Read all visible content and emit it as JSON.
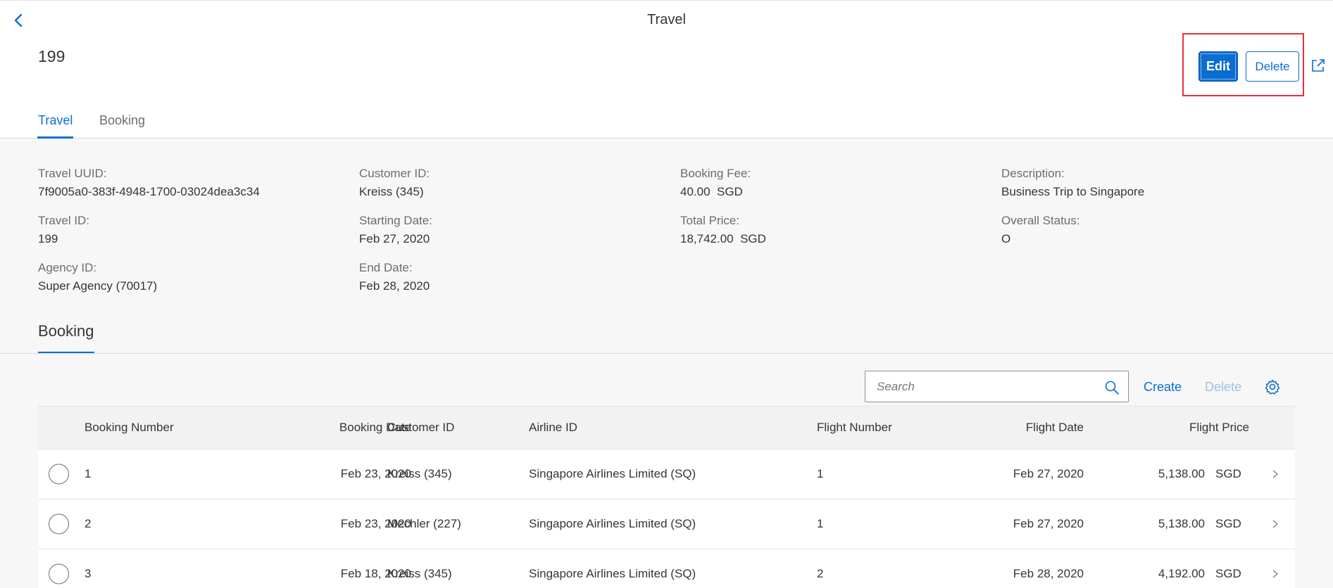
{
  "header": {
    "app_title": "Travel",
    "object_title": "199",
    "edit_label": "Edit",
    "delete_label": "Delete",
    "tabs": [
      {
        "label": "Travel",
        "selected": true
      },
      {
        "label": "Booking",
        "selected": false
      }
    ]
  },
  "details": {
    "fields": [
      {
        "label": "Travel UUID:",
        "value": "7f9005a0-383f-4948-1700-03024dea3c34"
      },
      {
        "label": "Travel ID:",
        "value": "199"
      },
      {
        "label": "Agency ID:",
        "value": "Super Agency (70017)"
      },
      {
        "label": "Customer ID:",
        "value": "Kreiss (345)"
      },
      {
        "label": "Starting Date:",
        "value": "Feb 27, 2020"
      },
      {
        "label": "End Date:",
        "value": "Feb 28, 2020"
      },
      {
        "label": "Booking Fee:",
        "value": "40.00  SGD"
      },
      {
        "label": "Total Price:",
        "value": "18,742.00  SGD"
      },
      {
        "label": "Description:",
        "value": "Business Trip to Singapore"
      },
      {
        "label": "Overall Status:",
        "value": "O"
      }
    ]
  },
  "booking": {
    "section_title": "Booking",
    "search_placeholder": "Search",
    "create_label": "Create",
    "delete_label": "Delete",
    "columns": [
      "Booking Number",
      "Booking Date",
      "Customer ID",
      "Airline ID",
      "Flight Number",
      "Flight Date",
      "Flight Price"
    ],
    "rows": [
      {
        "number": "1",
        "date": "Feb 23, 2020",
        "customer": "Kreiss (345)",
        "airline": "Singapore Airlines Limited (SQ)",
        "flight_number": "1",
        "flight_date": "Feb 27, 2020",
        "price": "5,138.00",
        "currency": "SGD"
      },
      {
        "number": "2",
        "date": "Feb 23, 2020",
        "customer": "Mechler (227)",
        "airline": "Singapore Airlines Limited (SQ)",
        "flight_number": "1",
        "flight_date": "Feb 27, 2020",
        "price": "5,138.00",
        "currency": "SGD"
      },
      {
        "number": "3",
        "date": "Feb 18, 2020",
        "customer": "Kreiss (345)",
        "airline": "Singapore Airlines Limited (SQ)",
        "flight_number": "2",
        "flight_date": "Feb 28, 2020",
        "price": "4,192.00",
        "currency": "SGD"
      }
    ]
  },
  "colors": {
    "accent": "#0a6ed1",
    "highlight_box": "#e8303a"
  },
  "icons": [
    "back-icon",
    "share-icon",
    "search-icon",
    "settings-icon",
    "chevron-right-icon"
  ]
}
